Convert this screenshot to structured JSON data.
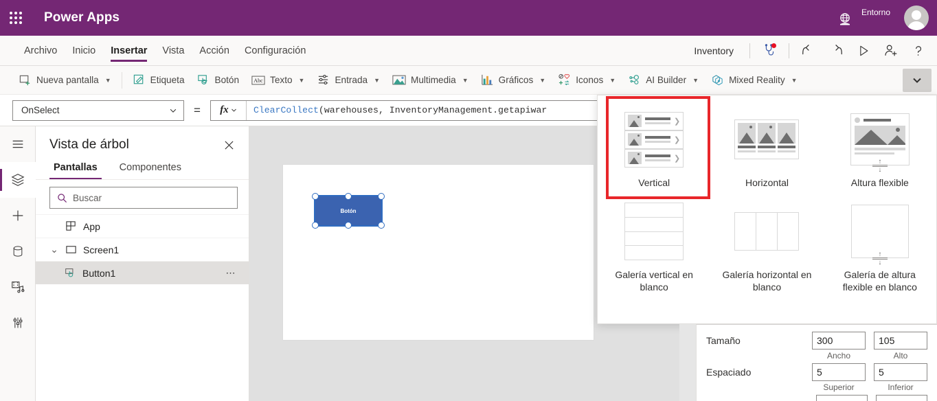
{
  "topbar": {
    "brand": "Power Apps",
    "waffle_icon": "app-launcher-icon",
    "environment_icon": "globe-environment-icon",
    "environment_label": "Entorno",
    "avatar_icon": "user-avatar"
  },
  "menubar": {
    "items": [
      {
        "label": "Archivo",
        "active": false
      },
      {
        "label": "Inicio",
        "active": false
      },
      {
        "label": "Insertar",
        "active": true
      },
      {
        "label": "Vista",
        "active": false
      },
      {
        "label": "Acción",
        "active": false
      },
      {
        "label": "Configuración",
        "active": false
      }
    ],
    "app_name": "Inventory",
    "commands": [
      {
        "name": "app-checker-icon",
        "title": "App checker",
        "badge": true
      },
      {
        "name": "undo-icon",
        "title": "Deshacer"
      },
      {
        "name": "redo-icon",
        "title": "Rehacer"
      },
      {
        "name": "play-icon",
        "title": "Vista previa"
      },
      {
        "name": "share-icon",
        "title": "Compartir"
      },
      {
        "name": "help-icon",
        "title": "Ayuda"
      }
    ]
  },
  "ribbon": {
    "items": [
      {
        "label": "Nueva pantalla",
        "icon": "new-screen-icon",
        "caret": true
      },
      {
        "label": "Etiqueta",
        "icon": "label-icon",
        "caret": false
      },
      {
        "label": "Botón",
        "icon": "button-icon",
        "caret": false
      },
      {
        "label": "Texto",
        "icon": "text-abc-icon",
        "caret": true
      },
      {
        "label": "Entrada",
        "icon": "input-sliders-icon",
        "caret": true
      },
      {
        "label": "Multimedia",
        "icon": "media-image-icon",
        "caret": true
      },
      {
        "label": "Gráficos",
        "icon": "charts-bar-icon",
        "caret": true
      },
      {
        "label": "Iconos",
        "icon": "icons-shapes-icon",
        "caret": true
      },
      {
        "label": "AI Builder",
        "icon": "ai-builder-icon",
        "caret": true
      },
      {
        "label": "Mixed Reality",
        "icon": "mixed-reality-icon",
        "caret": true
      }
    ],
    "expand_icon": "chevron-down-icon"
  },
  "formula_bar": {
    "property": "OnSelect",
    "equals": "=",
    "fx_label": "fx",
    "fx_caret_icon": "chevron-down-icon",
    "formula_function": "ClearCollect",
    "formula_rest": "(warehouses, InventoryManagement.getapiwar"
  },
  "rail": {
    "items": [
      {
        "name": "hamburger-menu-icon",
        "selected": false
      },
      {
        "name": "tree-view-layers-icon",
        "selected": true
      },
      {
        "name": "insert-plus-icon",
        "selected": false
      },
      {
        "name": "data-source-icon",
        "selected": false
      },
      {
        "name": "media-icon",
        "selected": false
      },
      {
        "name": "advanced-tools-icon",
        "selected": false
      }
    ]
  },
  "tree_panel": {
    "title": "Vista de árbol",
    "close_icon": "close-icon",
    "tabs": [
      {
        "label": "Pantallas",
        "active": true
      },
      {
        "label": "Componentes",
        "active": false
      }
    ],
    "search_placeholder": "Buscar",
    "search_value": "",
    "search_icon": "search-icon",
    "rows": [
      {
        "label": "App",
        "icon": "app-icon",
        "level": 0,
        "selected": false,
        "twisty": "",
        "menu": false
      },
      {
        "label": "Screen1",
        "icon": "screen-icon",
        "level": 0,
        "selected": false,
        "twisty": "⌄",
        "menu": false
      },
      {
        "label": "Button1",
        "icon": "button-icon",
        "level": 1,
        "selected": true,
        "twisty": "",
        "menu": true,
        "menu_icon": "more-options-icon"
      }
    ]
  },
  "canvas": {
    "button_label": "Botón",
    "button_color": "#3b63b0",
    "selection_color": "#2f6cc0"
  },
  "gallery_flyout": {
    "highlight_color": "#e8262a",
    "items": [
      {
        "label": "Vertical",
        "thumb": "vertical-gallery-thumb",
        "highlighted": true
      },
      {
        "label": "Horizontal",
        "thumb": "horizontal-gallery-thumb",
        "highlighted": false
      },
      {
        "label": "Altura flexible",
        "thumb": "flexible-height-gallery-thumb",
        "highlighted": false
      },
      {
        "label": "Galería vertical en blanco",
        "thumb": "blank-vertical-gallery-thumb",
        "highlighted": false
      },
      {
        "label": "Galería horizontal en blanco",
        "thumb": "blank-horizontal-gallery-thumb",
        "highlighted": false
      },
      {
        "label": "Galería de altura flexible en blanco",
        "thumb": "blank-flexible-gallery-thumb",
        "highlighted": false
      }
    ]
  },
  "properties": {
    "rows": [
      {
        "name": "Tamaño",
        "fields": [
          {
            "value": "300",
            "sub": "Ancho"
          },
          {
            "value": "105",
            "sub": "Alto"
          }
        ]
      },
      {
        "name": "Espaciado",
        "fields": [
          {
            "value": "5",
            "sub": "Superior"
          },
          {
            "value": "5",
            "sub": "Inferior"
          }
        ]
      }
    ]
  }
}
